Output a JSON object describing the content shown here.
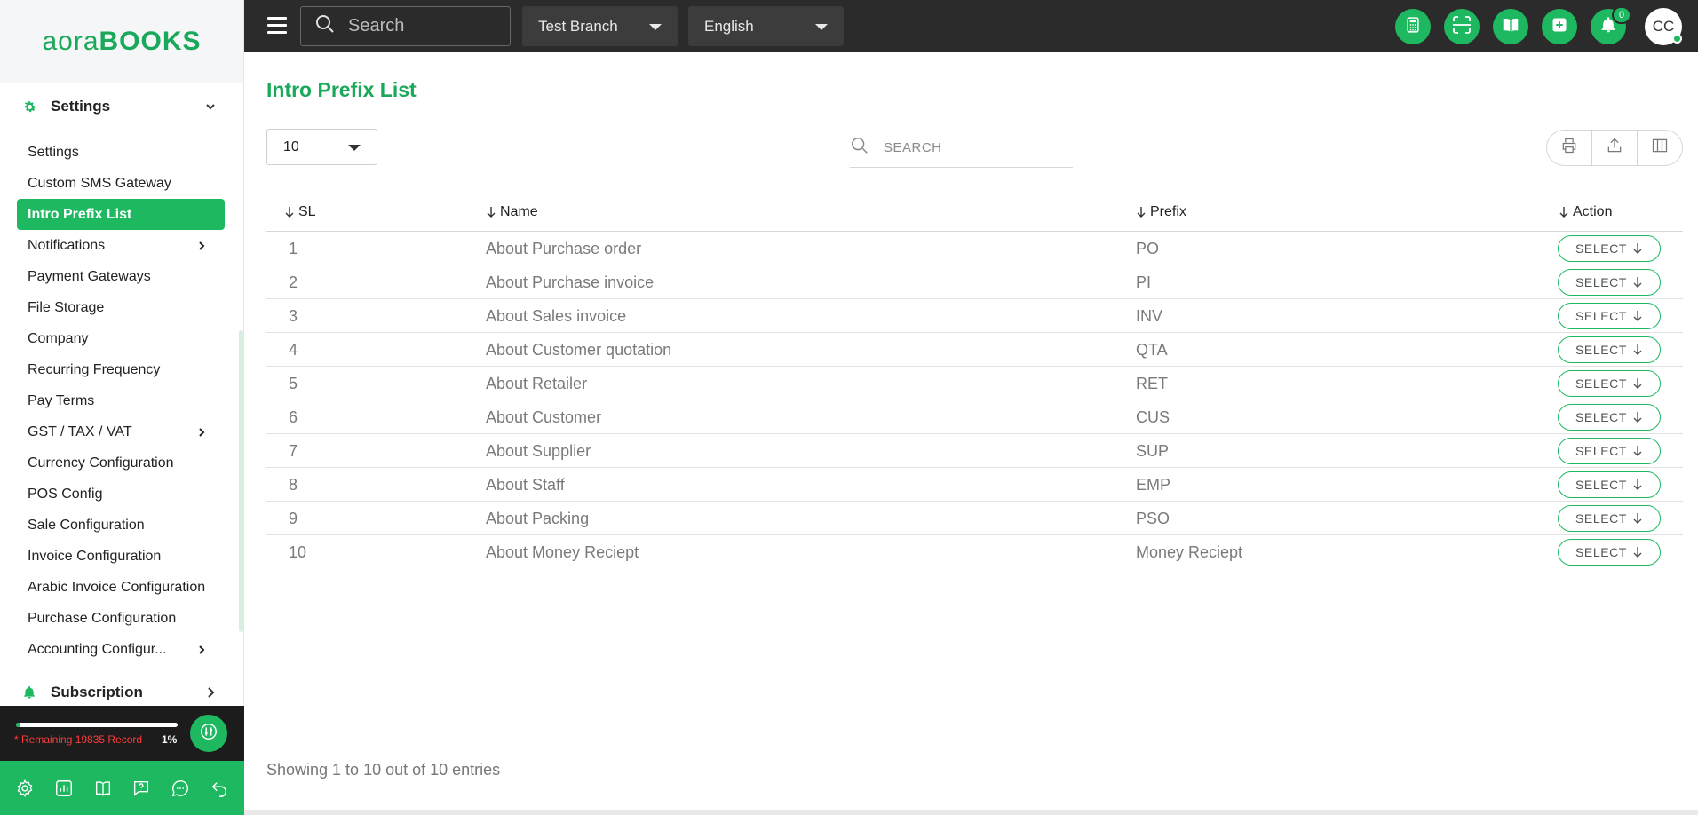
{
  "brand": {
    "logo_light": "aora",
    "logo_bold": "BOOKS",
    "accent": "#1db860"
  },
  "topbar": {
    "search_placeholder": "Search",
    "branch": "Test Branch",
    "language": "English",
    "notification_count": "0",
    "avatar_initials": "CC",
    "icons": [
      "calculator-icon",
      "scan-icon",
      "book-icon",
      "plus-square-icon",
      "bell-icon"
    ]
  },
  "sidebar": {
    "section_settings": "Settings",
    "items": [
      {
        "label": "Settings"
      },
      {
        "label": "Custom SMS Gateway"
      },
      {
        "label": "Intro Prefix List",
        "active": true
      },
      {
        "label": "Notifications",
        "has_children": true
      },
      {
        "label": "Payment Gateways"
      },
      {
        "label": "File Storage"
      },
      {
        "label": "Company"
      },
      {
        "label": "Recurring Frequency"
      },
      {
        "label": "Pay Terms"
      },
      {
        "label": "GST / TAX / VAT",
        "has_children": true
      },
      {
        "label": "Currency Configuration"
      },
      {
        "label": "POS Config"
      },
      {
        "label": "Sale Configuration"
      },
      {
        "label": "Invoice Configuration"
      },
      {
        "label": "Arabic Invoice Configuration"
      },
      {
        "label": "Purchase Configuration"
      },
      {
        "label": "Accounting Configur...",
        "has_children": true
      }
    ],
    "section_subscription": "Subscription",
    "quota": {
      "text": "* Remaining 19835 Record",
      "percent": "1%",
      "fraction": 0.01
    },
    "bottom_icons": [
      "gear-icon",
      "chart-icon",
      "book-open-icon",
      "help-icon",
      "chat-icon",
      "back-arrow-icon"
    ]
  },
  "main": {
    "title": "Intro Prefix List",
    "page_size": "10",
    "search_placeholder": "SEARCH",
    "columns": {
      "sl": "SL",
      "name": "Name",
      "prefix": "Prefix",
      "action": "Action"
    },
    "select_label": "SELECT",
    "rows": [
      {
        "sl": "1",
        "name": "About Purchase order",
        "prefix": "PO"
      },
      {
        "sl": "2",
        "name": "About Purchase invoice",
        "prefix": "PI"
      },
      {
        "sl": "3",
        "name": "About Sales invoice",
        "prefix": "INV"
      },
      {
        "sl": "4",
        "name": "About Customer quotation",
        "prefix": "QTA"
      },
      {
        "sl": "5",
        "name": "About Retailer",
        "prefix": "RET"
      },
      {
        "sl": "6",
        "name": "About Customer",
        "prefix": "CUS"
      },
      {
        "sl": "7",
        "name": "About Supplier",
        "prefix": "SUP"
      },
      {
        "sl": "8",
        "name": "About Staff",
        "prefix": "EMP"
      },
      {
        "sl": "9",
        "name": "About Packing",
        "prefix": "PSO"
      },
      {
        "sl": "10",
        "name": "About Money Reciept",
        "prefix": "Money Reciept"
      }
    ],
    "footer": "Showing 1 to 10 out of 10 entries"
  }
}
